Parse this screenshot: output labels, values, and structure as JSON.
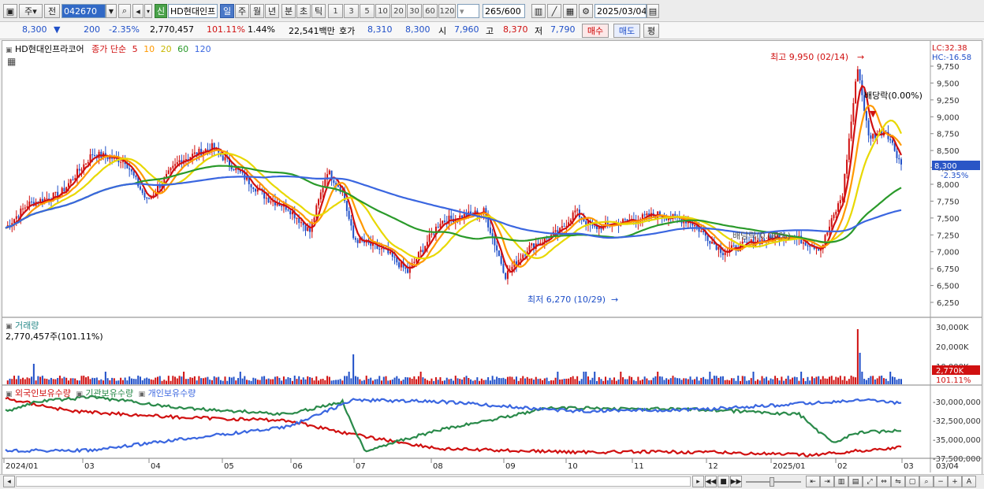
{
  "toolbar": {
    "market_label": "주",
    "prev_label": "전",
    "code": "042670",
    "new_badge": "신",
    "stock_name": "HD현대인프",
    "periods": [
      "일",
      "주",
      "월",
      "년",
      "분",
      "초",
      "틱"
    ],
    "intervals": [
      "1",
      "3",
      "5",
      "10",
      "20",
      "30",
      "60",
      "120"
    ],
    "count": "265",
    "count_max": "/600",
    "date": "2025/03/04"
  },
  "quote": {
    "price": "8,300",
    "change": "200",
    "change_pct": "-2.35%",
    "volume": "2,770,457",
    "volume_ratio": "101.11%",
    "turnover_pct": "1.44%",
    "amount": "22,541백만",
    "hoga_label": "호가",
    "hoga_ask": "8,310",
    "hoga_bid": "8,300",
    "open_label": "시",
    "open": "7,960",
    "high_label": "고",
    "high": "8,370",
    "low_label": "저",
    "low": "7,790",
    "buy_label": "매수",
    "sell_label": "매도",
    "eval_label": "평"
  },
  "price_panel": {
    "name": "HD현대인프라코어",
    "ma_title": "종가 단순",
    "ma_periods": [
      "5",
      "10",
      "20",
      "60",
      "120"
    ],
    "ma_colors": [
      "#d01010",
      "#ff9900",
      "#e8d800",
      "#2a9a2a",
      "#3a66e0"
    ],
    "lc_label": "LC:32.38",
    "hc_label": "HC:-16.58",
    "yticks": [
      "9,750",
      "9,500",
      "9,250",
      "9,000",
      "8,750",
      "8,500",
      "8,250",
      "8,000",
      "7,750",
      "7,500",
      "7,250",
      "7,000",
      "6,750",
      "6,500",
      "6,250"
    ],
    "current_tag": "8,300",
    "current_pct": "-2.35%",
    "high_note": "최고 9,950 (02/14)",
    "low_note": "최저 6,270 (10/29)",
    "dividend_note": "배당락(0.00%)",
    "dividend_note2": "배당락(0.00%)"
  },
  "volume_panel": {
    "title": "거래량",
    "value": "2,770,457주(101.11%)",
    "yticks": [
      "30,000K",
      "20,000K",
      "10,000K"
    ],
    "current_tag": "2,770K",
    "current_pct": "101.11%"
  },
  "holding_panel": {
    "legend": [
      "외국인보유수량",
      "기관보유수량",
      "개인보유수량"
    ],
    "legend_colors": [
      "#d01010",
      "#2a8a4a",
      "#3a66e0"
    ],
    "yticks": [
      "-30,000,000",
      "-32,500,000",
      "-35,000,000",
      "-37,500,000"
    ]
  },
  "xaxis": {
    "labels": [
      "2024/01",
      "03",
      "04",
      "05",
      "06",
      "07",
      "08",
      "09",
      "10",
      "11",
      "12",
      "2025/01",
      "02",
      "03"
    ],
    "right_label": "03/04"
  },
  "colors": {
    "up": "#d01010",
    "down": "#1f4fc8",
    "accent": "#3169c6"
  }
}
